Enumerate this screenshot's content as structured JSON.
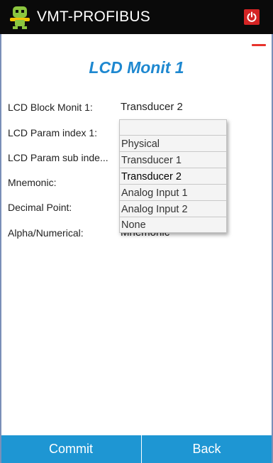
{
  "app": {
    "title": "VMT-PROFIBUS"
  },
  "page": {
    "title": "LCD Monit 1"
  },
  "form": {
    "rows": [
      {
        "label": "LCD Block Monit 1:",
        "value": "Transducer 2"
      },
      {
        "label": "LCD Param index 1:",
        "value": ""
      },
      {
        "label": "LCD Param sub inde...",
        "value": ""
      },
      {
        "label": "Mnemonic:",
        "value": ""
      },
      {
        "label": "Decimal Point:",
        "value": ""
      },
      {
        "label": "Alpha/Numerical:",
        "value": "Mnemonic"
      }
    ]
  },
  "dropdown": {
    "options": [
      "",
      "Physical",
      "Transducer 1",
      "Transducer 2",
      "Analog Input 1",
      "Analog Input 2",
      "None"
    ],
    "selected": "Transducer 2"
  },
  "footer": {
    "commit_label": "Commit",
    "back_label": "Back"
  },
  "icons": {
    "app_logo": "robot-logo-icon",
    "power": "power-icon",
    "menu": "menu-dash-icon"
  },
  "colors": {
    "accent": "#1e96d3",
    "title": "#1e88d0",
    "power": "#d42424",
    "titlebar": "#0a0a0a"
  }
}
